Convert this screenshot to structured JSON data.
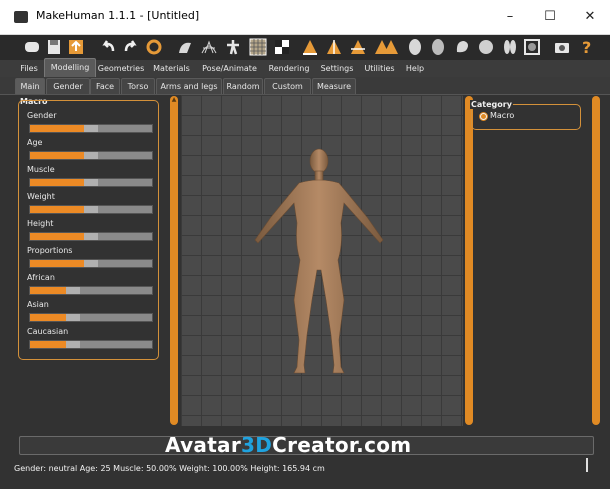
{
  "window": {
    "title": "MakeHuman 1.1.1 - [Untitled]",
    "minimize_glyph": "–",
    "maximize_glyph": "☐",
    "close_glyph": "✕"
  },
  "toolbar": {
    "icons": [
      "load-icon",
      "save-icon",
      "export-icon",
      "undo-icon",
      "redo-icon",
      "reset-icon",
      "smooth-icon",
      "wireframe-icon",
      "pose-icon",
      "grid-icon",
      "checker-icon",
      "front-view-icon",
      "back-view-icon",
      "side-view-icon",
      "left-view-icon",
      "top-view-icon",
      "head-view-icon",
      "face-view-icon",
      "ear-view-icon",
      "sphere-view-icon",
      "hands-view-icon",
      "frame-icon",
      "screenshot-icon",
      "help-icon"
    ],
    "help_glyph": "?"
  },
  "main_tabs": [
    {
      "label": "Files",
      "active": false
    },
    {
      "label": "Modelling",
      "active": true
    },
    {
      "label": "Geometries",
      "active": false
    },
    {
      "label": "Materials",
      "active": false
    },
    {
      "label": "Pose/Animate",
      "active": false
    },
    {
      "label": "Rendering",
      "active": false
    },
    {
      "label": "Settings",
      "active": false
    },
    {
      "label": "Utilities",
      "active": false
    },
    {
      "label": "Help",
      "active": false
    }
  ],
  "sub_tabs": [
    {
      "label": "Main",
      "active": true
    },
    {
      "label": "Gender",
      "active": false
    },
    {
      "label": "Face",
      "active": false
    },
    {
      "label": "Torso",
      "active": false
    },
    {
      "label": "Arms and legs",
      "active": false
    },
    {
      "label": "Random",
      "active": false
    },
    {
      "label": "Custom",
      "active": false
    },
    {
      "label": "Measure",
      "active": false
    }
  ],
  "macro": {
    "title": "Macro",
    "sliders": [
      {
        "label": "Gender",
        "value": 0.5
      },
      {
        "label": "Age",
        "value": 0.5
      },
      {
        "label": "Muscle",
        "value": 0.5
      },
      {
        "label": "Weight",
        "value": 0.5
      },
      {
        "label": "Height",
        "value": 0.5
      },
      {
        "label": "Proportions",
        "value": 0.5
      },
      {
        "label": "African",
        "value": 0.33
      },
      {
        "label": "Asian",
        "value": 0.33
      },
      {
        "label": "Caucasian",
        "value": 0.33
      }
    ]
  },
  "category": {
    "title": "Category",
    "option": "Macro"
  },
  "watermark": {
    "part1": "Avatar",
    "part2": "3D",
    "part3": "Creator.com"
  },
  "status": "Gender: neutral Age: 25 Muscle: 50.00% Weight: 100.00% Height: 165.94 cm",
  "colors": {
    "accent": "#e08a24",
    "panel_border": "#d4913a",
    "background": "#323232"
  }
}
